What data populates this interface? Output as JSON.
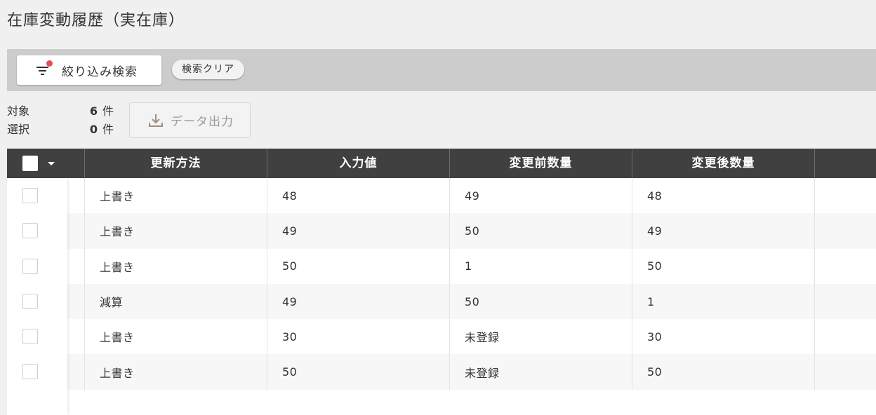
{
  "page": {
    "title": "在庫変動履歴（実在庫）"
  },
  "search": {
    "filter_label": "絞り込み検索",
    "clear_label": "検索クリア"
  },
  "summary": {
    "target_label": "対象",
    "target_value": "6",
    "selected_label": "選択",
    "selected_value": "0",
    "unit": "件"
  },
  "export": {
    "label": "データ出力"
  },
  "table": {
    "columns": [
      "更新方法",
      "入力値",
      "変更前数量",
      "変更後数量",
      ""
    ],
    "rows": [
      {
        "method": "上書き",
        "input": "48",
        "before": "49",
        "after": "48"
      },
      {
        "method": "上書き",
        "input": "49",
        "before": "50",
        "after": "49"
      },
      {
        "method": "上書き",
        "input": "50",
        "before": "1",
        "after": "50"
      },
      {
        "method": "減算",
        "input": "49",
        "before": "50",
        "after": "1"
      },
      {
        "method": "上書き",
        "input": "30",
        "before": "未登録",
        "after": "30"
      },
      {
        "method": "上書き",
        "input": "50",
        "before": "未登録",
        "after": "50"
      }
    ]
  },
  "colors": {
    "page_bg": "#f0f0f0",
    "toolbar_bg": "#cccccc",
    "header_bg": "#404040",
    "notification_dot": "#e0505a",
    "disabled_text": "#9a9a9a"
  },
  "icons": {
    "filter": "filter-icon",
    "download": "download-icon",
    "caret": "caret-down-icon"
  }
}
